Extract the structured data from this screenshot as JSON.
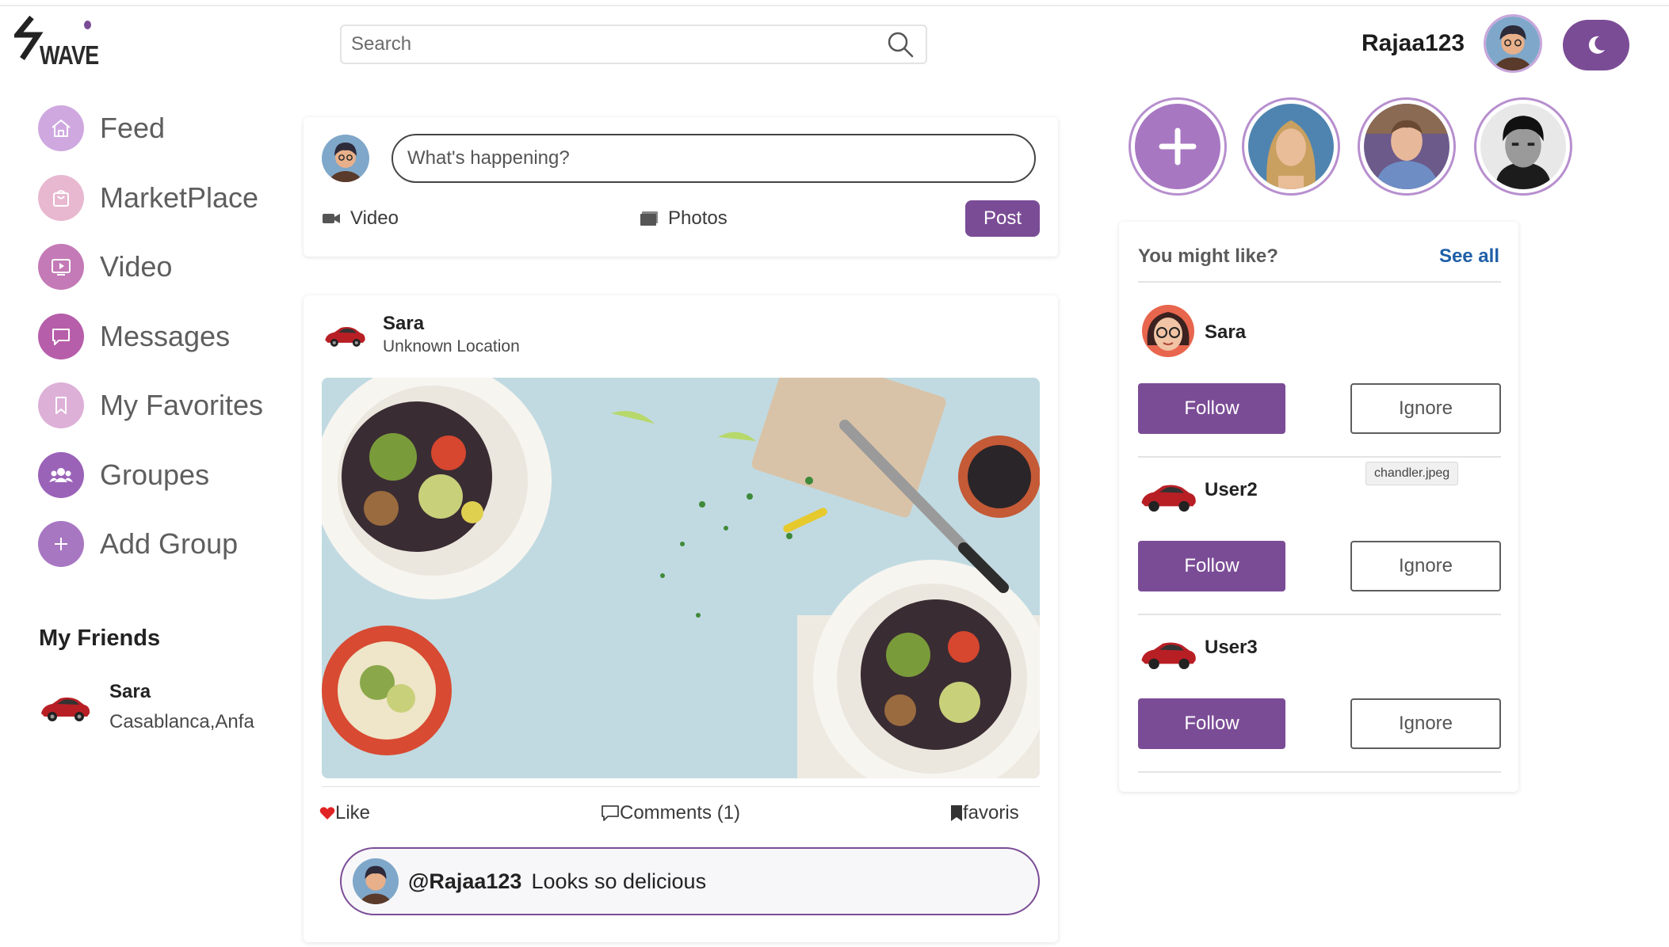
{
  "app": {
    "logo_text": "WAVE"
  },
  "header": {
    "search_placeholder": "Search",
    "username": "Rajaa123",
    "search_icon": "search-icon",
    "theme_icon": "moon-icon"
  },
  "colors": {
    "accent": "#7b4c96",
    "accent_light": "#c8a6dc",
    "link": "#1f5fa8",
    "like": "#e02424"
  },
  "sidebar": {
    "items": [
      {
        "label": "Feed",
        "icon": "home-icon",
        "color": "#cfa8e0"
      },
      {
        "label": "MarketPlace",
        "icon": "shopping-bag-icon",
        "color": "#e8b8d0"
      },
      {
        "label": "Video",
        "icon": "video-screen-icon",
        "color": "#c47ab6"
      },
      {
        "label": "Messages",
        "icon": "chat-icon",
        "color": "#b75eab"
      },
      {
        "label": "My Favorites",
        "icon": "bookmark-icon",
        "color": "#ddb0d8"
      },
      {
        "label": "Groupes",
        "icon": "group-icon",
        "color": "#9a63b8"
      },
      {
        "label": "Add Group",
        "icon": "plus-icon",
        "color": "#a877c2"
      }
    ],
    "friends_title": "My Friends",
    "friends": [
      {
        "name": "Sara",
        "location": "Casablanca,Anfa"
      }
    ]
  },
  "composer": {
    "placeholder": "What's happening?",
    "video_label": "Video",
    "photos_label": "Photos",
    "post_label": "Post"
  },
  "post": {
    "author": "Sara",
    "location": "Unknown Location",
    "like_label": "Like",
    "comments_label": "Comments (1)",
    "favoris_label": "favoris",
    "comment": {
      "user": "@Rajaa123",
      "text": "Looks so delicious"
    }
  },
  "stories": [
    {
      "name": "add-story",
      "icon": "plus-icon"
    },
    {
      "name": "story-1"
    },
    {
      "name": "story-2"
    },
    {
      "name": "story-3"
    }
  ],
  "suggestions": {
    "title": "You might like?",
    "see_all": "See all",
    "users": [
      {
        "name": "Sara",
        "follow": "Follow",
        "ignore": "Ignore"
      },
      {
        "name": "User2",
        "follow": "Follow",
        "ignore": "Ignore"
      },
      {
        "name": "User3",
        "follow": "Follow",
        "ignore": "Ignore"
      }
    ],
    "tooltip": "chandler.jpeg"
  }
}
